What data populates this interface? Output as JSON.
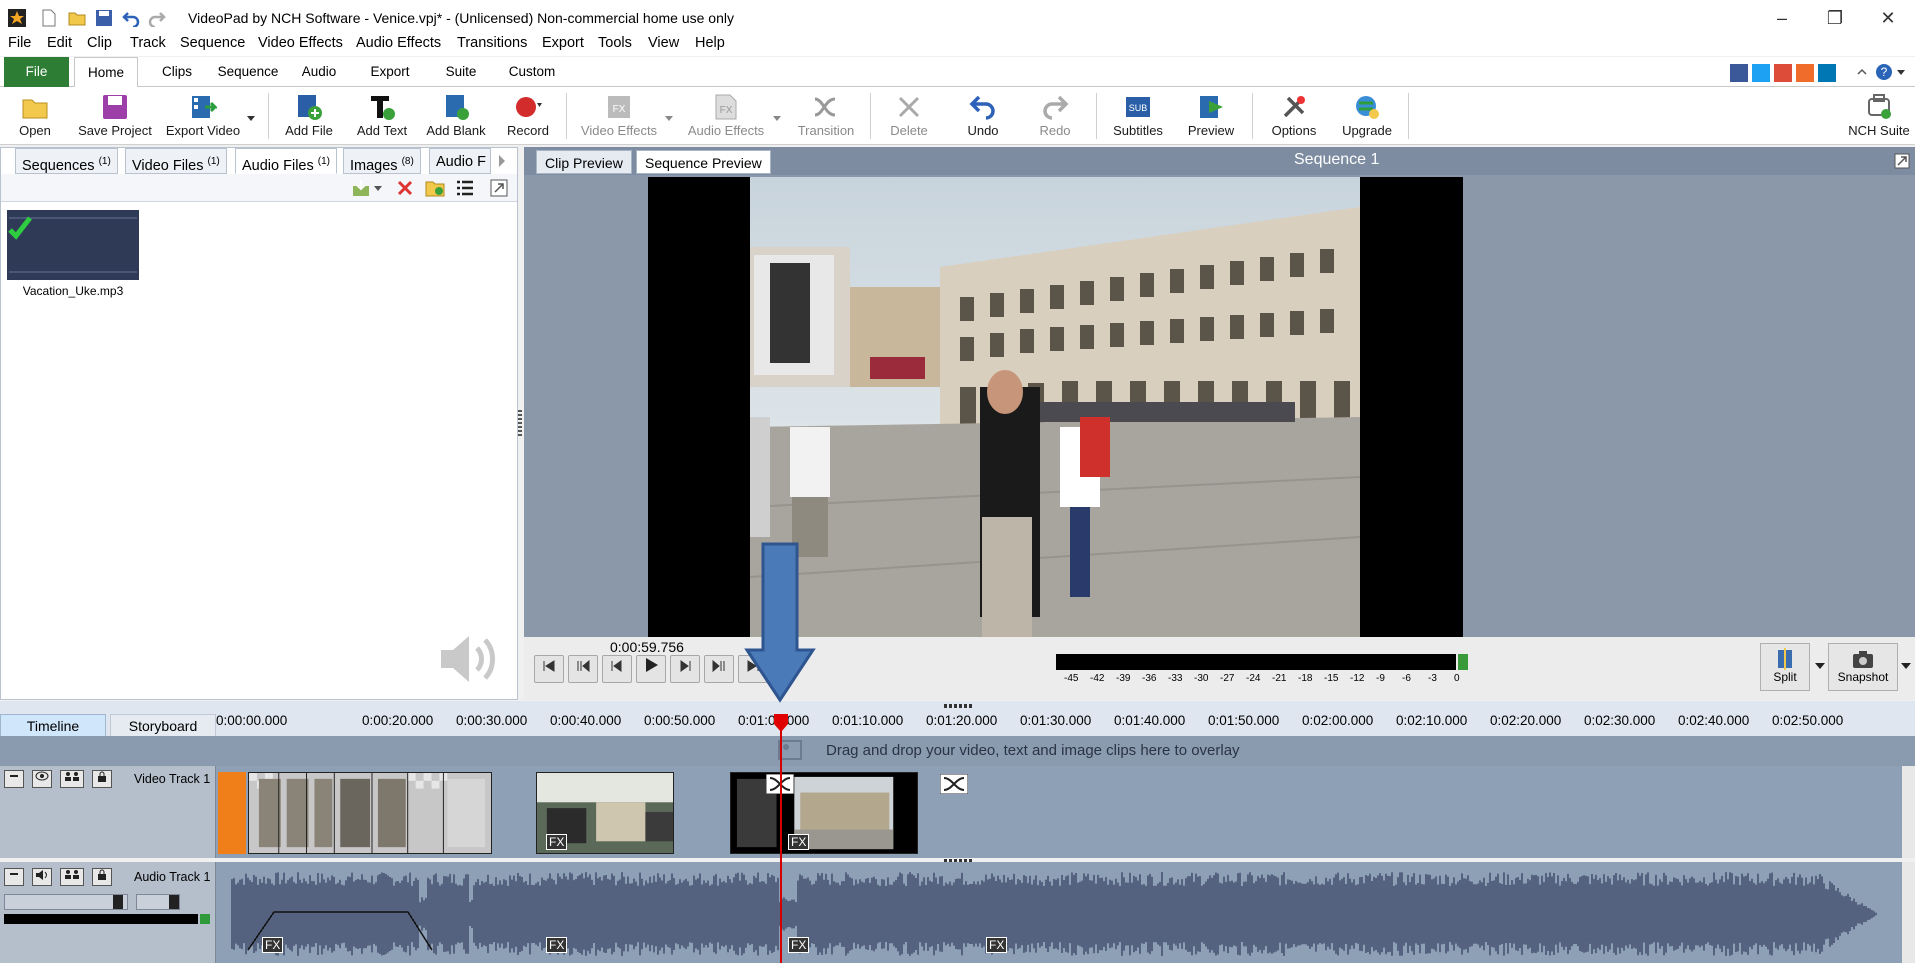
{
  "window": {
    "title": "VideoPad by NCH Software - Venice.vpj* - (Unlicensed) Non-commercial home use only",
    "controls": [
      "–",
      "❐",
      "✕"
    ]
  },
  "menu": [
    "File",
    "Edit",
    "Clip",
    "Track",
    "Sequence",
    "Video Effects",
    "Audio Effects",
    "Transitions",
    "Export",
    "Tools",
    "View",
    "Help"
  ],
  "ribbon_tabs": [
    "File",
    "Home",
    "Clips",
    "Sequence",
    "Audio",
    "Export",
    "Suite",
    "Custom"
  ],
  "toolbar": {
    "open": "Open",
    "save_project": "Save Project",
    "export_video": "Export Video",
    "add_file": "Add File",
    "add_text": "Add Text",
    "add_blank": "Add Blank",
    "record": "Record",
    "video_effects": "Video Effects",
    "audio_effects": "Audio Effects",
    "transition": "Transition",
    "delete": "Delete",
    "undo": "Undo",
    "redo": "Redo",
    "subtitles": "Subtitles",
    "preview": "Preview",
    "options": "Options",
    "upgrade": "Upgrade",
    "nch_suite": "NCH Suite",
    "sub_glyph": "SUB",
    "fx_glyph": "FX"
  },
  "bin_tabs": [
    {
      "label": "Sequences",
      "count": "(1)"
    },
    {
      "label": "Video Files",
      "count": "(1)"
    },
    {
      "label": "Audio Files",
      "count": "(1)"
    },
    {
      "label": "Images",
      "count": "(8)"
    },
    {
      "label": "Audio F",
      "count": ""
    }
  ],
  "bin_items": [
    {
      "name": "Vacation_Uke.mp3"
    }
  ],
  "preview": {
    "tabs": [
      "Clip Preview",
      "Sequence Preview"
    ],
    "sequence_title": "Sequence 1",
    "timecode": "0:00:59.756",
    "meter_labels": [
      "-45",
      "-42",
      "-39",
      "-36",
      "-33",
      "-30",
      "-27",
      "-24",
      "-21",
      "-18",
      "-15",
      "-12",
      "-9",
      "-6",
      "-3",
      "0"
    ],
    "split": "Split",
    "snapshot": "Snapshot"
  },
  "timeline": {
    "tabs": [
      "Timeline",
      "Storyboard"
    ],
    "ruler": [
      "0:00:00.000",
      "0:00:20.000",
      "0:00:30.000",
      "0:00:40.000",
      "0:00:50.000",
      "0:01:00.000",
      "0:01:10.000",
      "0:01:20.000",
      "0:01:30.000",
      "0:01:40.000",
      "0:01:50.000",
      "0:02:00.000",
      "0:02:10.000",
      "0:02:20.000",
      "0:02:30.000",
      "0:02:40.000",
      "0:02:50.000"
    ],
    "overlay_hint": "Drag and drop your video, text and image clips here to overlay",
    "video_track": "Video Track 1",
    "audio_track": "Audio Track 1",
    "fx_label": "FX"
  },
  "colors": {
    "file_tab": "#2d7d34",
    "playhead": "#d40000",
    "annotation_arrow": "#4a7ab8"
  }
}
